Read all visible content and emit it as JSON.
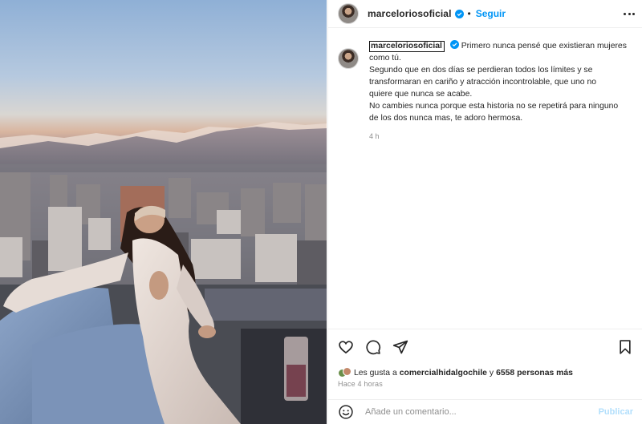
{
  "post": {
    "username": "marceloriosoficial",
    "separator": "•",
    "follow_label": "Seguir",
    "caption_lines": [
      "Primero nunca pensé que existieran mujeres",
      "como tú.",
      "Segundo que en dos días se perdieran todos los límites y se",
      "transformaran en cariño y atracción incontrolable, que uno no",
      "quiere que nunca se acabe.",
      "No cambies nunca porque esta historia no se repetirá para ninguno",
      "de los dos nunca mas, te adoro hermosa."
    ],
    "caption_time": "4 h",
    "likes_prefix": "Les gusta a",
    "likes_user": "comercialhidalgochile",
    "likes_middle": "y",
    "likes_count": "6558 personas más",
    "posted_ago": "Hace 4 horas"
  },
  "comment": {
    "placeholder": "Añade un comentario...",
    "publish_label": "Publicar"
  },
  "colors": {
    "accent": "#0095f6",
    "publish_disabled": "#b2dffc",
    "text": "#262626",
    "muted": "#8e8e8e"
  },
  "icons": {
    "verified": "verified-badge-icon",
    "more": "more-options-icon",
    "like": "heart-icon",
    "comment": "comment-bubble-icon",
    "share": "paper-plane-icon",
    "save": "bookmark-icon",
    "emoji": "smiley-face-icon"
  }
}
